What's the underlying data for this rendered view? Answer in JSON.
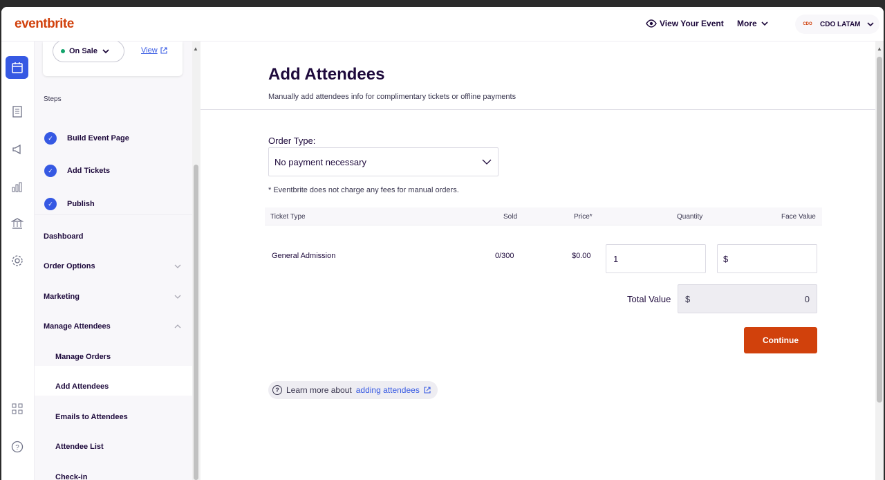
{
  "header": {
    "logo": "eventbrite",
    "view_event": "View Your Event",
    "more": "More",
    "account_name": "CDO LATAM",
    "account_logo": "CDO"
  },
  "sidebar": {
    "status": "On Sale",
    "view_link": "View",
    "steps_label": "Steps",
    "steps": [
      "Build Event Page",
      "Add Tickets",
      "Publish"
    ],
    "nav": [
      "Dashboard",
      "Order Options",
      "Marketing",
      "Manage Attendees"
    ],
    "subnav": [
      "Manage Orders",
      "Add Attendees",
      "Emails to Attendees",
      "Attendee List",
      "Check-in"
    ]
  },
  "main": {
    "title": "Add Attendees",
    "subtitle": "Manually add attendees info for complimentary tickets or offline payments",
    "order_type_label": "Order Type:",
    "order_type_value": "No payment necessary",
    "fee_note": "* Eventbrite does not charge any fees for manual orders.",
    "table": {
      "headers": [
        "Ticket Type",
        "Sold",
        "Price",
        "Quantity",
        "Face Value"
      ],
      "rows": [
        {
          "ticket_type": "General Admission",
          "sold": "0/300",
          "price": "$0.00",
          "quantity": "1",
          "face_value_prefix": "$"
        }
      ]
    },
    "total_label": "Total Value",
    "total_prefix": "$",
    "total_value": "0",
    "continue_label": "Continue",
    "help_text": "Learn more about",
    "help_link": "adding attendees"
  },
  "colors": {
    "brand": "#d1410c",
    "accent": "#3659e3",
    "success": "#14a46c"
  }
}
